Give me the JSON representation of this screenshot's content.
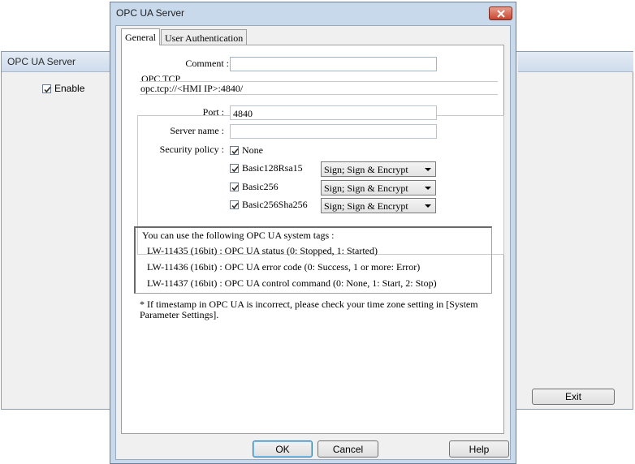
{
  "background_window": {
    "title": "OPC UA Server",
    "enable_label": "Enable",
    "exit_label": "Exit"
  },
  "dialog": {
    "title": "OPC UA Server",
    "tabs": [
      {
        "label": "General",
        "active": true
      },
      {
        "label": "User Authentication",
        "active": false
      }
    ],
    "comment_label": "Comment :",
    "comment_value": "",
    "group_title": "OPC TCP",
    "url": "opc.tcp://<HMI IP>:4840/",
    "port_label": "Port :",
    "port_value": "4840",
    "server_name_label": "Server name :",
    "server_name_value": "",
    "security_policy_label": "Security policy :",
    "policies": [
      {
        "name": "None",
        "checked": true,
        "mode": ""
      },
      {
        "name": "Basic128Rsa15",
        "checked": true,
        "mode": "Sign; Sign & Encrypt"
      },
      {
        "name": "Basic256",
        "checked": true,
        "mode": "Sign; Sign & Encrypt"
      },
      {
        "name": "Basic256Sha256",
        "checked": true,
        "mode": "Sign; Sign & Encrypt"
      }
    ],
    "tags_intro": "You can use the following OPC UA system tags :",
    "tags": [
      "LW-11435 (16bit) : OPC UA status (0: Stopped, 1: Started)",
      "LW-11436 (16bit) : OPC UA error code (0: Success, 1 or more: Error)",
      "LW-11437 (16bit) : OPC UA control command (0: None, 1: Start, 2: Stop)"
    ],
    "note": "* If timestamp in OPC UA is incorrect, please check your time zone setting in [System Parameter Settings].",
    "ok_label": "OK",
    "cancel_label": "Cancel",
    "help_label": "Help"
  },
  "colors": {
    "title_bar": "#c9d9ec",
    "close_button": "#c8442c",
    "dialog_face": "#f0f0f0"
  }
}
